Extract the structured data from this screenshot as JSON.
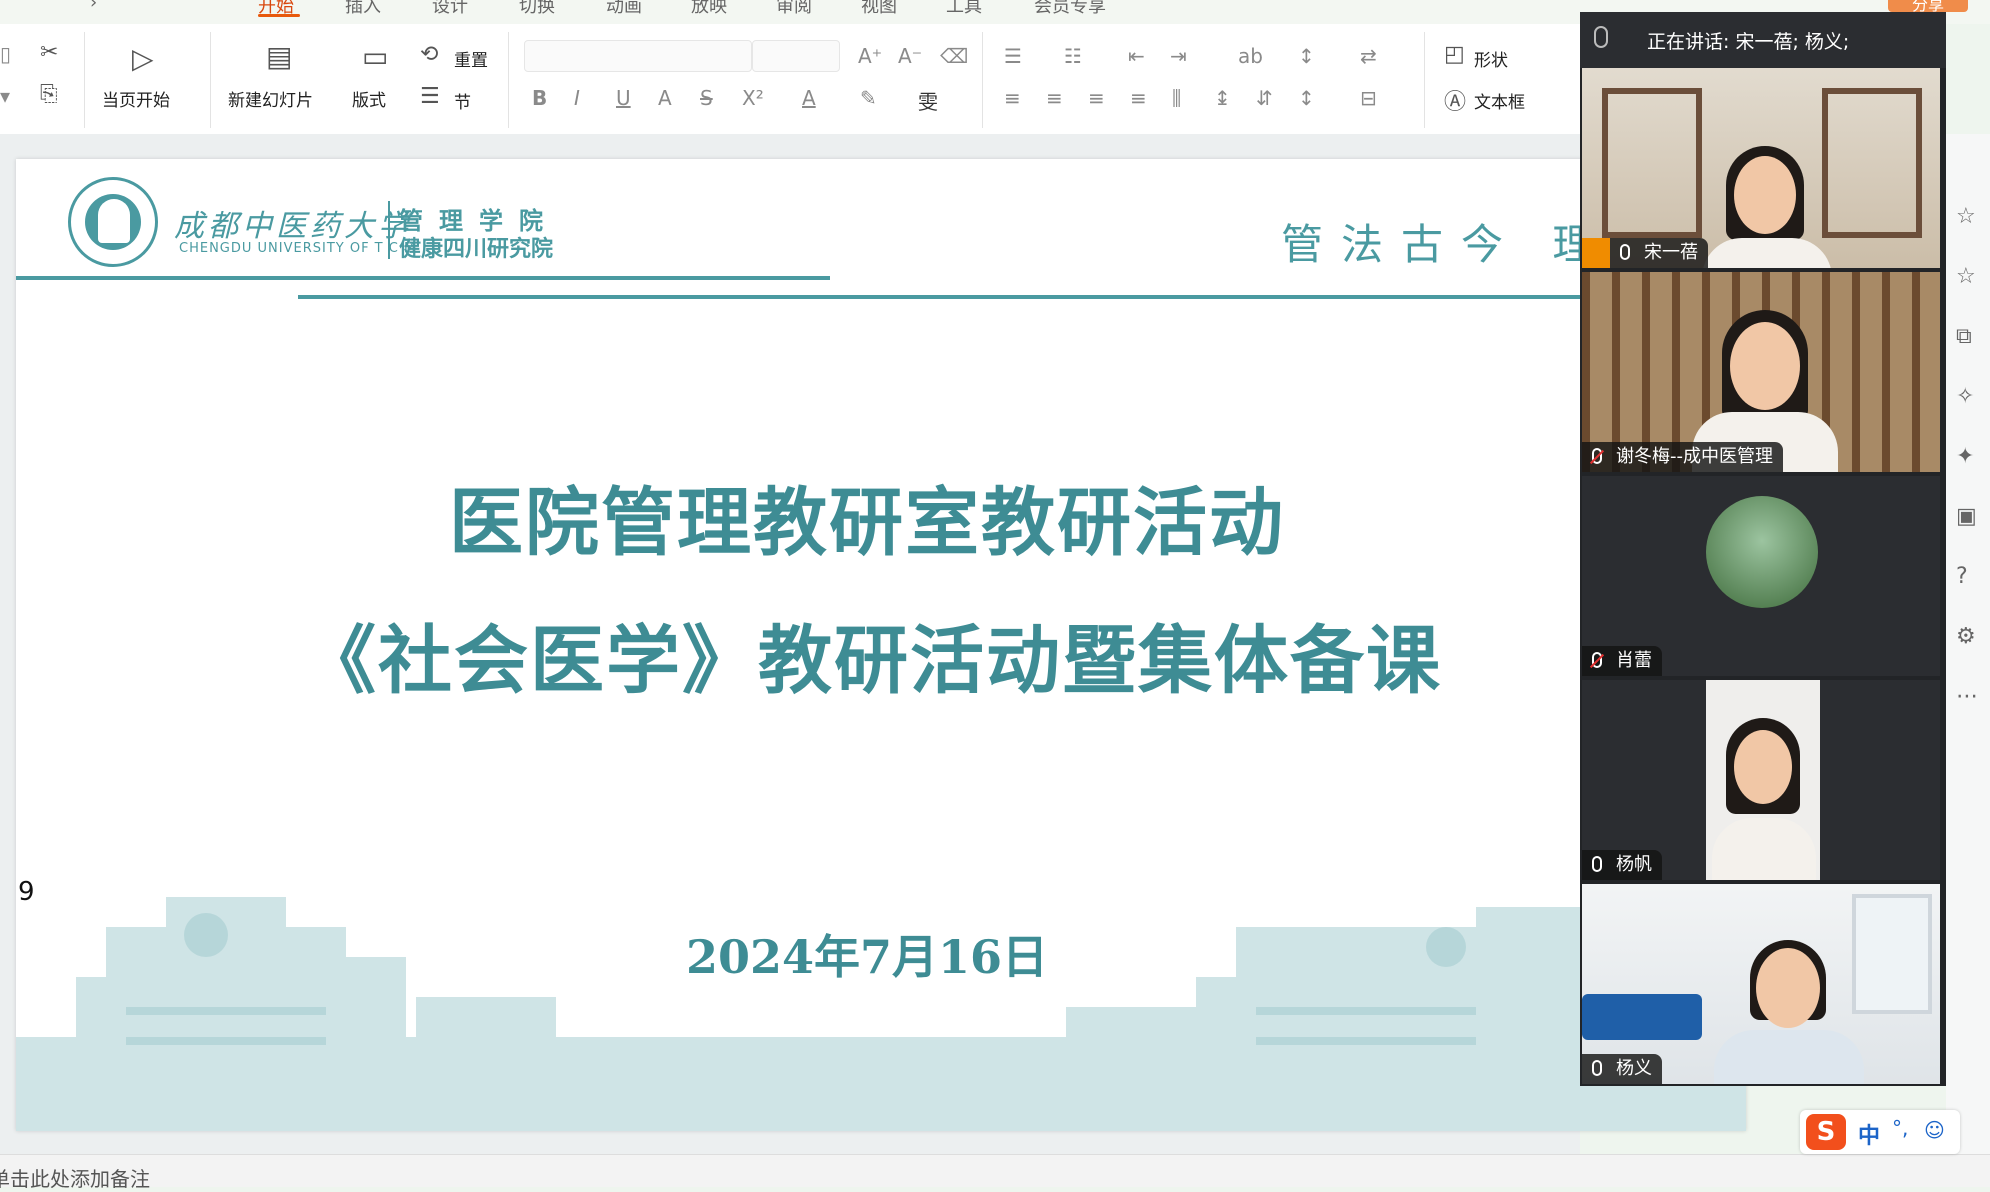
{
  "top_tabs": [
    "开始",
    "插入",
    "设计",
    "切换",
    "动画",
    "放映",
    "审阅",
    "视图",
    "工具",
    "会员专享"
  ],
  "active_tab": "开始",
  "share_label": "分享",
  "ribbon": {
    "start_from_current": "当页开始",
    "new_slide": "新建幻灯片",
    "layout": "版式",
    "reset": "重置",
    "section": "节",
    "shape": "形状",
    "textbox": "文本框",
    "font_name": "",
    "font_size": ""
  },
  "slide": {
    "university_cn": "成都中医药大学",
    "university_en": "CHENGDU UNIVERSITY OF T C M",
    "school_line1": "管理学院",
    "school_line2": "健康四川研究院",
    "motto": "管法古今 理术",
    "title_line1": "医院管理教研室教研活动",
    "title_line2": "《社会医学》教研活动暨集体备课",
    "date": "2024年7月16日",
    "page_number": "9"
  },
  "notes_placeholder": "单击此处添加备注",
  "meeting": {
    "speaking_label": "正在讲话:",
    "speaking_names": "宋一蓓; 杨义;",
    "participants": [
      {
        "name": "宋一蓓",
        "muted": false,
        "host": true,
        "active_speaker": true
      },
      {
        "name": "谢冬梅--成中医管理",
        "muted": true,
        "host": false,
        "active_speaker": false
      },
      {
        "name": "肖蕾",
        "muted": true,
        "host": false,
        "active_speaker": false
      },
      {
        "name": "杨帆",
        "muted": false,
        "host": false,
        "active_speaker": false
      },
      {
        "name": "杨义",
        "muted": false,
        "host": false,
        "active_speaker": false
      }
    ]
  },
  "ime": {
    "logo": "S",
    "mode": "中",
    "punct": "°,",
    "emoji_icon": "emoji-icon"
  },
  "colors": {
    "teal": "#3e8c94",
    "active_tab": "#e8590c",
    "speaker_outline": "#2fbf71",
    "host_badge": "#f08c00"
  }
}
